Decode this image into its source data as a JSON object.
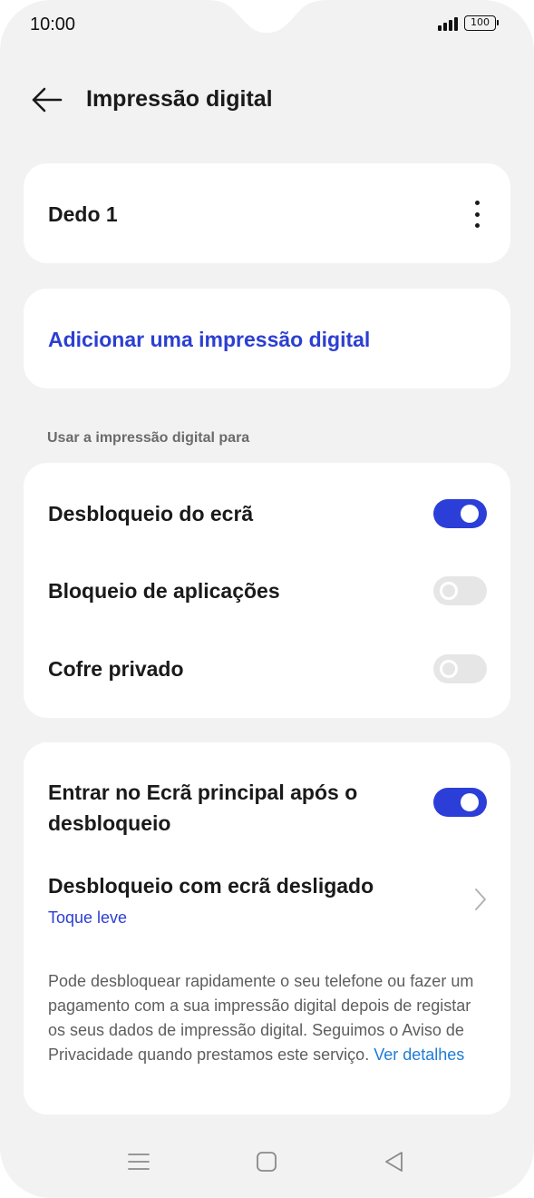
{
  "status": {
    "time": "10:00",
    "battery": "100"
  },
  "header": {
    "title": "Impressão digital"
  },
  "finger_card": {
    "name": "Dedo 1"
  },
  "add_card": {
    "label": "Adicionar uma impressão digital"
  },
  "section": {
    "label": "Usar a impressão digital para"
  },
  "usage": [
    {
      "label": "Desbloqueio do ecrã",
      "enabled": true
    },
    {
      "label": "Bloqueio de aplicações",
      "enabled": false
    },
    {
      "label": "Cofre privado",
      "enabled": false
    }
  ],
  "settings": {
    "home_after_unlock": {
      "line1": "Entrar no Ecrã principal após o",
      "line2": "desbloqueio",
      "enabled": true
    },
    "screen_off_unlock": {
      "label": "Desbloqueio com ecrã desligado",
      "value": "Toque leve"
    },
    "description": "Pode desbloquear rapidamente o seu telefone ou fazer um pagamento com a sua impressão digital depois de registar os seus dados de impressão digital. Seguimos o Aviso de Privacidade quando prestamos este serviço.",
    "details_link": "Ver detalhes"
  },
  "colors": {
    "accent": "#2b3fd8",
    "link": "#1f7bd6",
    "background": "#f2f2f2",
    "card": "#ffffff"
  },
  "icons": {
    "back": "arrow-left-icon",
    "more": "more-vertical-icon",
    "chevron": "chevron-right-icon",
    "nav_menu": "menu-icon",
    "nav_home": "home-square-icon",
    "nav_back": "back-triangle-icon"
  }
}
